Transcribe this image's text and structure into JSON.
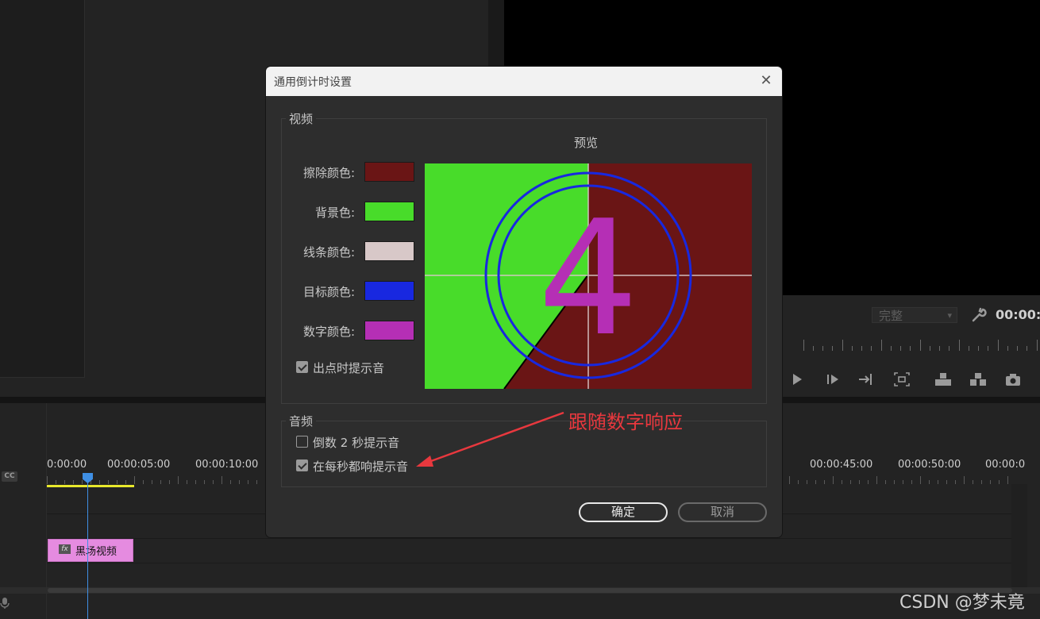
{
  "app": {
    "quality_label": "完整",
    "timecode_right": "00:00:0",
    "cc_label": "CC",
    "timeline_times": [
      "0:00:00",
      "00:00:05:00",
      "00:00:10:00",
      "00:00:45:00",
      "00:00:50:00",
      "00:00:0"
    ],
    "clip_fx": "fx",
    "clip_label": "黑场视频"
  },
  "dialog": {
    "title": "通用倒计时设置",
    "close_glyph": "✕",
    "video_group": "视频",
    "preview_label": "预览",
    "fields": [
      {
        "label": "擦除颜色:",
        "color": "#6a1515"
      },
      {
        "label": "背景色:",
        "color": "#48dc2a"
      },
      {
        "label": "线条颜色:",
        "color": "#d8c8c8"
      },
      {
        "label": "目标颜色:",
        "color": "#1828e0"
      },
      {
        "label": "数字颜色:",
        "color": "#b52fb5"
      }
    ],
    "cue_at_out": {
      "label": "出点时提示音",
      "checked": true
    },
    "preview_digit": "4",
    "audio_group": "音频",
    "cue_2sec": {
      "label": "倒数 2 秒提示音",
      "checked": false
    },
    "cue_every_sec": {
      "label": "在每秒都响提示音",
      "checked": true
    },
    "ok_label": "确定",
    "cancel_label": "取消"
  },
  "annotation": "跟随数字响应",
  "watermark": "CSDN @梦未竟"
}
